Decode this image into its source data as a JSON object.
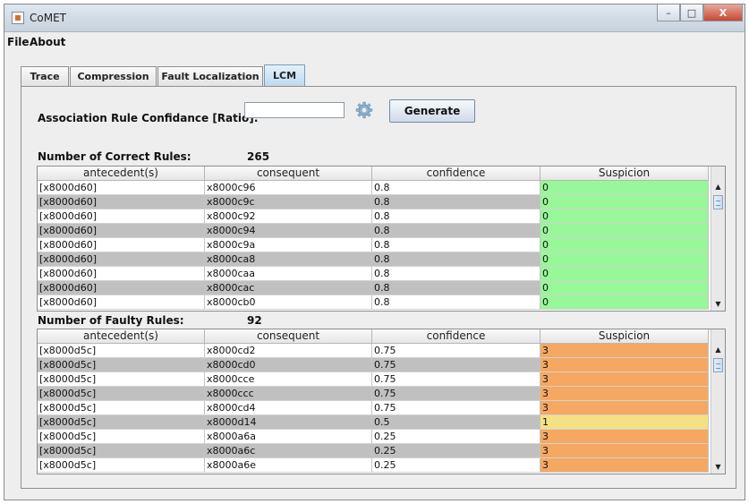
{
  "window": {
    "title": "CoMET",
    "minimize": "–",
    "maximize": "□",
    "close": "X"
  },
  "menu": [
    "File",
    "About"
  ],
  "tabs": [
    {
      "label": "Trace",
      "active": false
    },
    {
      "label": "Compression",
      "active": false
    },
    {
      "label": "Fault Localization",
      "active": false
    },
    {
      "label": "LCM",
      "active": true
    }
  ],
  "lcm": {
    "confidence_label": "Association Rule Confidance [Ratio]:",
    "confidence_value": "",
    "generate_label": "Generate"
  },
  "correct": {
    "label": "Number of Correct Rules:",
    "count": "265",
    "columns": [
      "antecedent(s)",
      "consequent",
      "confidence",
      "Suspicion"
    ],
    "rows": [
      [
        "[x8000d60]",
        "x8000c96",
        "0.8",
        "0"
      ],
      [
        "[x8000d60]",
        "x8000c9c",
        "0.8",
        "0"
      ],
      [
        "[x8000d60]",
        "x8000c92",
        "0.8",
        "0"
      ],
      [
        "[x8000d60]",
        "x8000c94",
        "0.8",
        "0"
      ],
      [
        "[x8000d60]",
        "x8000c9a",
        "0.8",
        "0"
      ],
      [
        "[x8000d60]",
        "x8000ca8",
        "0.8",
        "0"
      ],
      [
        "[x8000d60]",
        "x8000caa",
        "0.8",
        "0"
      ],
      [
        "[x8000d60]",
        "x8000cac",
        "0.8",
        "0"
      ],
      [
        "[x8000d60]",
        "x8000cb0",
        "0.8",
        "0"
      ]
    ]
  },
  "faulty": {
    "label": "Number of Faulty Rules:",
    "count": "92",
    "columns": [
      "antecedent(s)",
      "consequent",
      "confidence",
      "Suspicion"
    ],
    "rows": [
      [
        "[x8000d5c]",
        "x8000cd2",
        "0.75",
        "3"
      ],
      [
        "[x8000d5c]",
        "x8000cd0",
        "0.75",
        "3"
      ],
      [
        "[x8000d5c]",
        "x8000cce",
        "0.75",
        "3"
      ],
      [
        "[x8000d5c]",
        "x8000ccc",
        "0.75",
        "3"
      ],
      [
        "[x8000d5c]",
        "x8000cd4",
        "0.75",
        "3"
      ],
      [
        "[x8000d5c]",
        "x8000d14",
        "0.5",
        "1"
      ],
      [
        "[x8000d5c]",
        "x8000a6a",
        "0.25",
        "3"
      ],
      [
        "[x8000d5c]",
        "x8000a6c",
        "0.25",
        "3"
      ],
      [
        "[x8000d5c]",
        "x8000a6e",
        "0.25",
        "3"
      ]
    ]
  },
  "colors": {
    "suspicion_0": "#98f798",
    "suspicion_1": "#f4e183",
    "suspicion_3": "#f4a862"
  }
}
